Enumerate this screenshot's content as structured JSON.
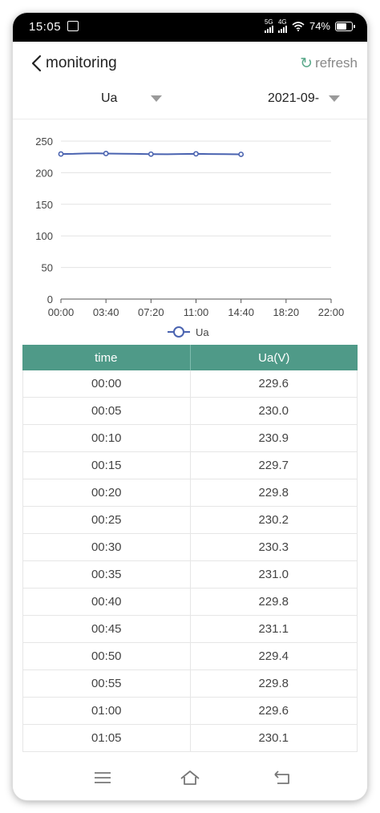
{
  "status_bar": {
    "time": "15:05",
    "network_1": "5G",
    "network_2": "4G",
    "battery": "74%",
    "battery_level": 0.74
  },
  "header": {
    "title": "monitoring",
    "refresh_label": "refresh"
  },
  "filters": {
    "parameter": "Ua",
    "date": "2021-09-"
  },
  "chart_data": {
    "type": "line",
    "x_ticks": [
      "00:00",
      "03:40",
      "07:20",
      "11:00",
      "14:40",
      "18:20",
      "22:00"
    ],
    "y_ticks": [
      "0",
      "50",
      "100",
      "150",
      "200",
      "250"
    ],
    "ylim": [
      0,
      250
    ],
    "x_range_minutes": [
      0,
      1320
    ],
    "grid": true,
    "legend_position": "bottom",
    "series": [
      {
        "name": "Ua",
        "color": "#4a63b0",
        "x_minutes": [
          0,
          60,
          120,
          180,
          220,
          300,
          360,
          440,
          520,
          580,
          660,
          720,
          800,
          880
        ],
        "values": [
          229.6,
          229.8,
          230.5,
          230.6,
          230.4,
          230.0,
          229.8,
          229.4,
          229.2,
          229.6,
          229.9,
          229.6,
          229.3,
          229.1
        ],
        "marker_x_minutes": [
          0,
          220,
          440,
          660,
          880
        ]
      }
    ]
  },
  "table": {
    "columns": [
      "time",
      "Ua(V)"
    ],
    "rows": [
      [
        "00:00",
        "229.6"
      ],
      [
        "00:05",
        "230.0"
      ],
      [
        "00:10",
        "230.9"
      ],
      [
        "00:15",
        "229.7"
      ],
      [
        "00:20",
        "229.8"
      ],
      [
        "00:25",
        "230.2"
      ],
      [
        "00:30",
        "230.3"
      ],
      [
        "00:35",
        "231.0"
      ],
      [
        "00:40",
        "229.8"
      ],
      [
        "00:45",
        "231.1"
      ],
      [
        "00:50",
        "229.4"
      ],
      [
        "00:55",
        "229.8"
      ],
      [
        "01:00",
        "229.6"
      ],
      [
        "01:05",
        "230.1"
      ]
    ]
  },
  "nav": {
    "icons": [
      "menu-icon",
      "home-icon",
      "back-nav-icon"
    ]
  }
}
